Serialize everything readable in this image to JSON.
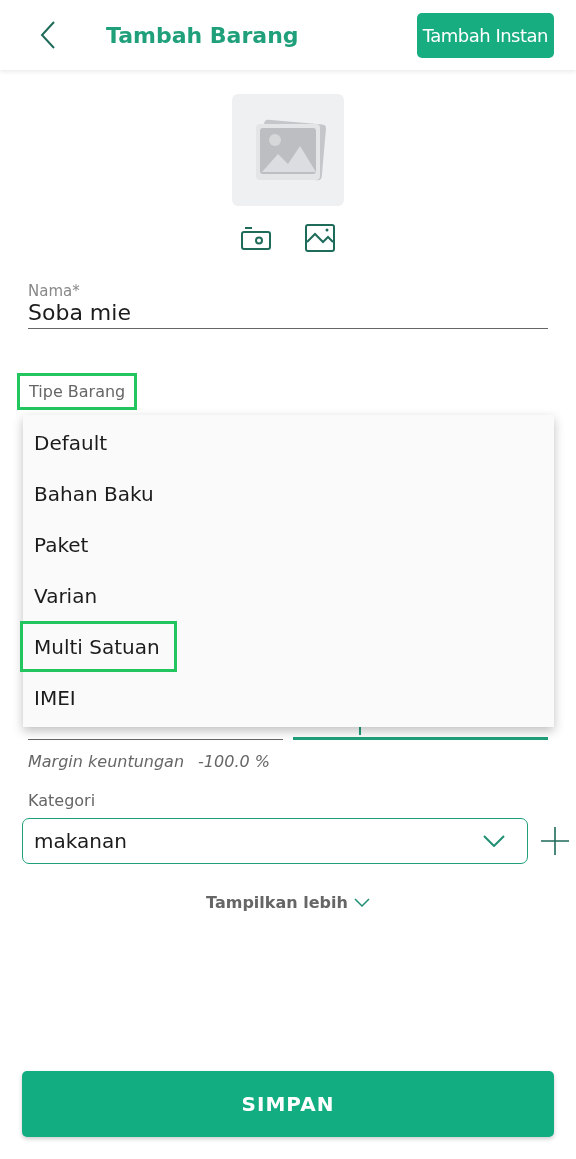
{
  "header": {
    "title": "Tambah Barang",
    "action": "Tambah Instan"
  },
  "name_field": {
    "label": "Nama*",
    "value": "Soba mie"
  },
  "type_field": {
    "label": "Tipe Barang",
    "highlighted": true
  },
  "type_menu": [
    {
      "label": "Default",
      "highlighted": false
    },
    {
      "label": "Bahan Baku",
      "highlighted": false
    },
    {
      "label": "Paket",
      "highlighted": false
    },
    {
      "label": "Varian",
      "highlighted": false
    },
    {
      "label": "Multi Satuan",
      "highlighted": true
    },
    {
      "label": "IMEI",
      "highlighted": false
    }
  ],
  "price_fields": [
    {
      "focused": false
    },
    {
      "focused": true
    }
  ],
  "margin": {
    "label": "Margin keuntungan",
    "value": "-100.0 %"
  },
  "category": {
    "label": "Kategori",
    "value": "makanan"
  },
  "show_more": "Tampilkan lebih",
  "save_button": "SIMPAN"
}
